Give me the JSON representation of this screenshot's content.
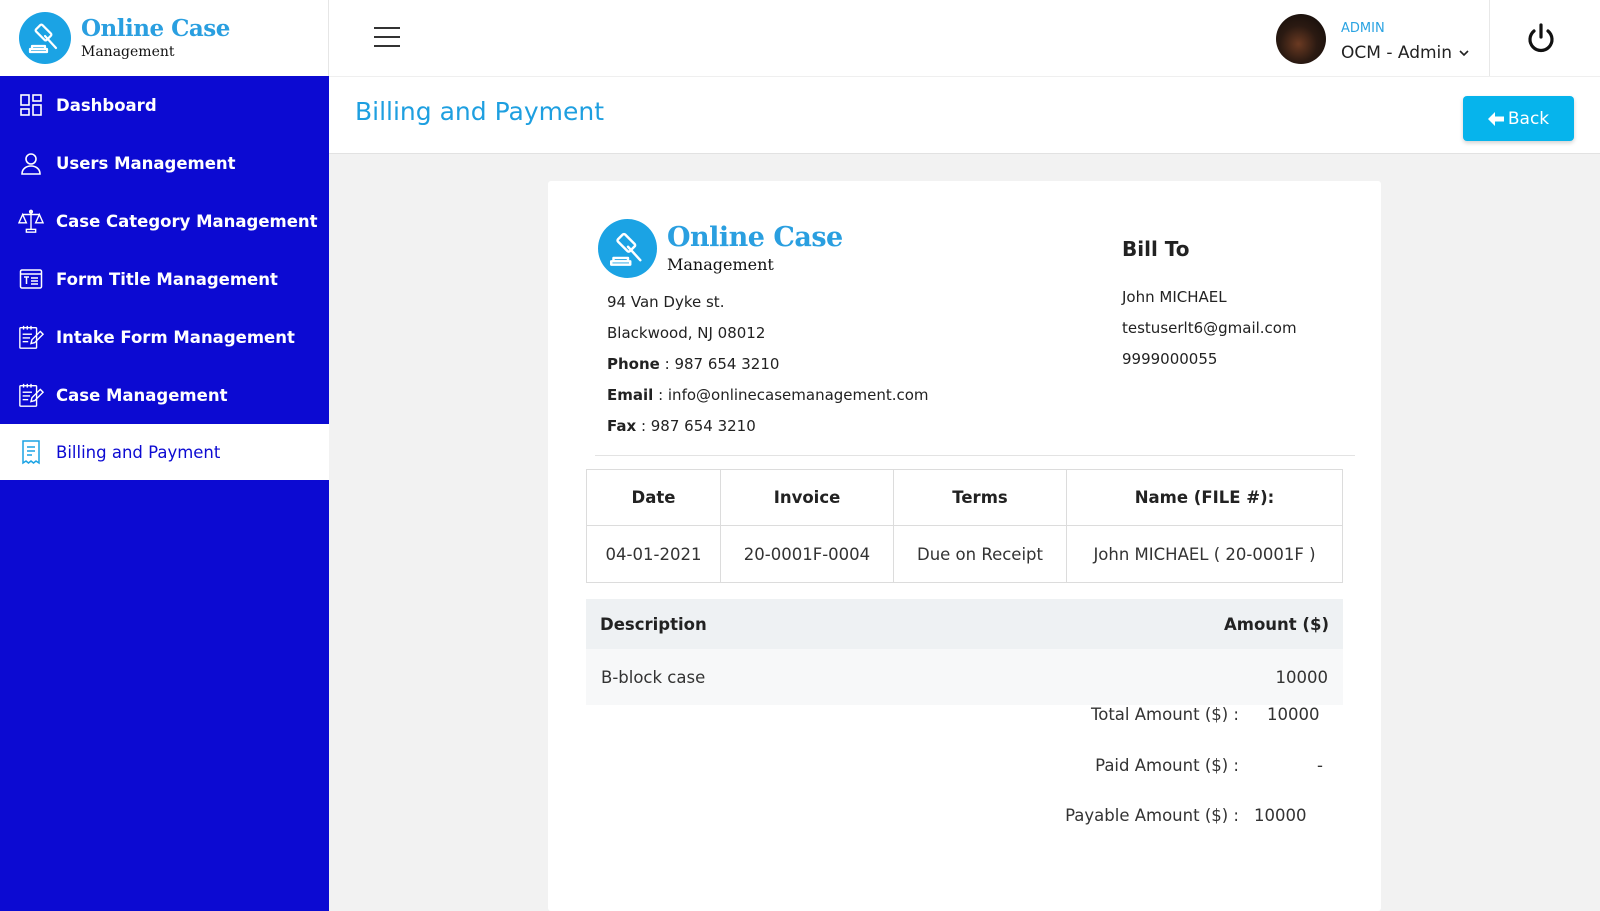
{
  "brand": {
    "title": "Online Case",
    "subtitle": "Management"
  },
  "sidebar": {
    "items": [
      {
        "label": "Dashboard",
        "icon": "dashboard-icon"
      },
      {
        "label": "Users Management",
        "icon": "user-icon"
      },
      {
        "label": "Case Category Management",
        "icon": "scales-icon"
      },
      {
        "label": "Form Title Management",
        "icon": "form-title-icon"
      },
      {
        "label": "Intake Form Management",
        "icon": "intake-form-icon"
      },
      {
        "label": "Case Management",
        "icon": "case-icon"
      },
      {
        "label": "Billing and Payment",
        "icon": "receipt-icon",
        "active": true
      }
    ]
  },
  "topbar": {
    "role": "ADMIN",
    "user_name": "OCM - Admin"
  },
  "page": {
    "title": "Billing and Payment",
    "back_label": "Back"
  },
  "invoice": {
    "company": {
      "title": "Online Case",
      "subtitle": "Management",
      "address1": "94 Van Dyke st.",
      "address2": "Blackwood, NJ 08012",
      "phone_label": "Phone",
      "phone": "987 654 3210",
      "email_label": "Email",
      "email": "info@onlinecasemanagement.com",
      "fax_label": "Fax",
      "fax": "987 654 3210"
    },
    "bill_to": {
      "heading": "Bill To",
      "name": "John MICHAEL",
      "email": "testuserlt6@gmail.com",
      "phone": "9999000055"
    },
    "meta": {
      "headers": [
        "Date",
        "Invoice",
        "Terms",
        "Name (FILE #):"
      ],
      "values": [
        "04-01-2021",
        "20-0001F-0004",
        "Due on Receipt",
        "John MICHAEL ( 20-0001F )"
      ]
    },
    "items": {
      "desc_header": "Description",
      "amount_header": "Amount ($)",
      "rows": [
        {
          "description": "B-block case",
          "amount": "10000"
        }
      ]
    },
    "summary": {
      "total_label": "Total Amount ($) :",
      "total": "10000",
      "paid_label": "Paid Amount ($) :",
      "paid": "-",
      "payable_label": "Payable Amount ($) :",
      "payable": "10000"
    }
  },
  "colors": {
    "sidebar": "#0c0ad2",
    "accent": "#1e9fe0",
    "button": "#06b4ec"
  }
}
